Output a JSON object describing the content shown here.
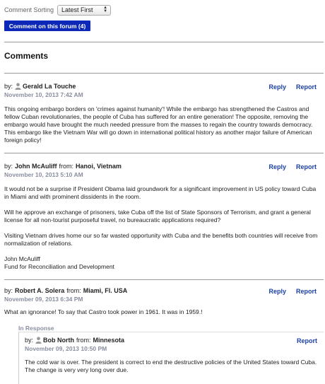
{
  "sort": {
    "label": "Comment Sorting",
    "selected": "Latest First"
  },
  "comment_button": "Comment on this forum (4)",
  "comments_heading": "Comments",
  "labels": {
    "by": "by:",
    "from": "from:",
    "reply": "Reply",
    "report": "Report",
    "in_response": "In Response"
  },
  "comments": [
    {
      "author": "Gerald La Touche",
      "location": "",
      "date": "November 10, 2013 7:42 AM",
      "paragraphs": [
        "This ongoing embargo borders on 'crimes against humanity'! While the embargo has strengthened the Castros and fellow Cuban revolutionaries, the people of Cuba has suffered for an entire generation! The opposite, removing the embargo would have brought the much needed pressure from the masses to regain the country towards democracy. This embargo like the Vietnam War will go down in international political history as another major failure of American foreign policy!"
      ]
    },
    {
      "author": "John McAuliff",
      "location": "Hanoi, Vietnam",
      "date": "November 10, 2013 5:10 AM",
      "paragraphs": [
        "It would not be a surprise if President Obama laid groundwork for a significant improvement in US policy toward Cuba in Miami and with prominent dissidents in the room.",
        "Will he approve an exchange of prisoners, take Cuba off the list of State Sponsors of Terrorism, and grant a general license for all non-tourist purposeful travel, no bureaucratic applications required?",
        "Visiting Vietnam drives home our so far wasted opportunity with Cuba and the benefits both countries will receive from normalization of relations.",
        "John McAuliff\nFund for Reconciliation and Development"
      ]
    },
    {
      "author": "Robert A. Solera",
      "location": "Miami, Fl. USA",
      "date": "November 09, 2013 6:34 PM",
      "paragraphs": [
        "What an ignorance! To say that Castro took power in 1961. It was in 1959.!"
      ]
    }
  ],
  "reply": {
    "author": "Bob North",
    "location": "Minnesota",
    "date": "November 09, 2013 10:50 PM",
    "paragraphs": [
      "The cold war is over. The president is correct to end the destructive policies of the United States toward Cuba. The change is very very long over due."
    ]
  }
}
